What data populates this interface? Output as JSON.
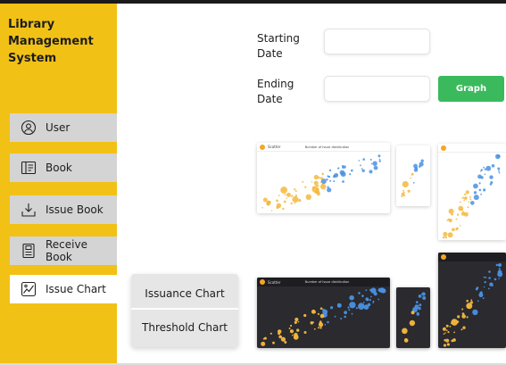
{
  "sidebar": {
    "title": "Library Management System",
    "items": [
      {
        "label": "User",
        "icon": "user-circle-icon"
      },
      {
        "label": "Book",
        "icon": "book-icon"
      },
      {
        "label": "Issue Book",
        "icon": "download-arrow-icon"
      },
      {
        "label": "Receive Book",
        "icon": "document-icon"
      },
      {
        "label": "Issue Chart",
        "icon": "chart-image-icon"
      }
    ],
    "active_item": "Issue Chart"
  },
  "submenu": {
    "items": [
      "Issuance Chart",
      "Threshold Chart"
    ]
  },
  "form": {
    "starting_date_label": "Starting Date",
    "starting_date_value": "",
    "ending_date_label": "Ending Date",
    "ending_date_value": "",
    "graph_button": "Graph"
  },
  "thumbnails": {
    "app_name": "Scatter",
    "chart_title": "Number of Issue distribution"
  },
  "colors": {
    "sidebar_bg": "#f2c115",
    "nav_item_bg": "#d4d4d4",
    "nav_item_active_bg": "#ffffff",
    "graph_button_bg": "#3aba5c",
    "bubble_yellow": "#f5b83d",
    "bubble_blue": "#4a90e2",
    "dark_chart_bg": "#2a2a2f"
  }
}
